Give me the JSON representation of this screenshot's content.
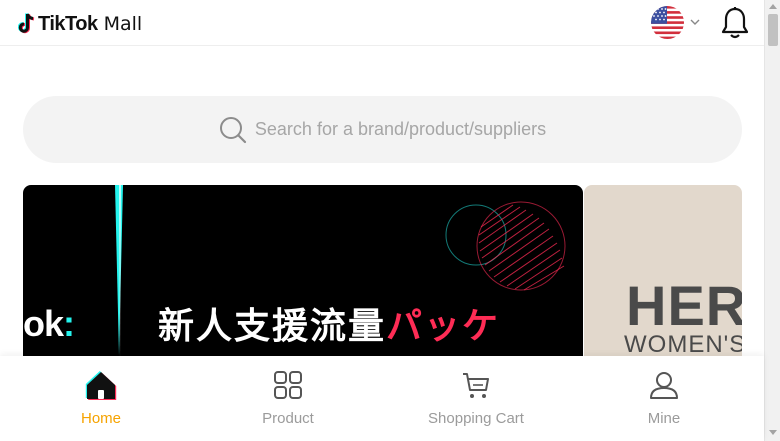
{
  "header": {
    "logo_name": "TikTok",
    "logo_sub": "Mall",
    "icons": {
      "logo": "tiktok-note-icon",
      "flag": "us-flag-icon",
      "dropdown": "chevron-down-icon",
      "notifications": "bell-icon"
    }
  },
  "search": {
    "placeholder": "Search for a brand/product/suppliers",
    "icon": "search-icon"
  },
  "banners": {
    "main": {
      "left_fragment": "ok",
      "left_colon": ":",
      "title_main": "新人支援流量",
      "title_accent": "パッケ"
    },
    "side": {
      "big": "HER",
      "small": "WOMEN'S"
    }
  },
  "bottom_nav": {
    "items": [
      {
        "label": "Home",
        "icon": "home-icon",
        "active": true
      },
      {
        "label": "Product",
        "icon": "grid-icon",
        "active": false
      },
      {
        "label": "Shopping Cart",
        "icon": "cart-icon",
        "active": false
      },
      {
        "label": "Mine",
        "icon": "user-icon",
        "active": false
      }
    ]
  },
  "colors": {
    "accent": "#f6a300",
    "tiktok_cyan": "#25f4ee",
    "tiktok_red": "#fe2c55",
    "inactive": "#9b9b9b",
    "search_bg": "#f3f3f3"
  }
}
